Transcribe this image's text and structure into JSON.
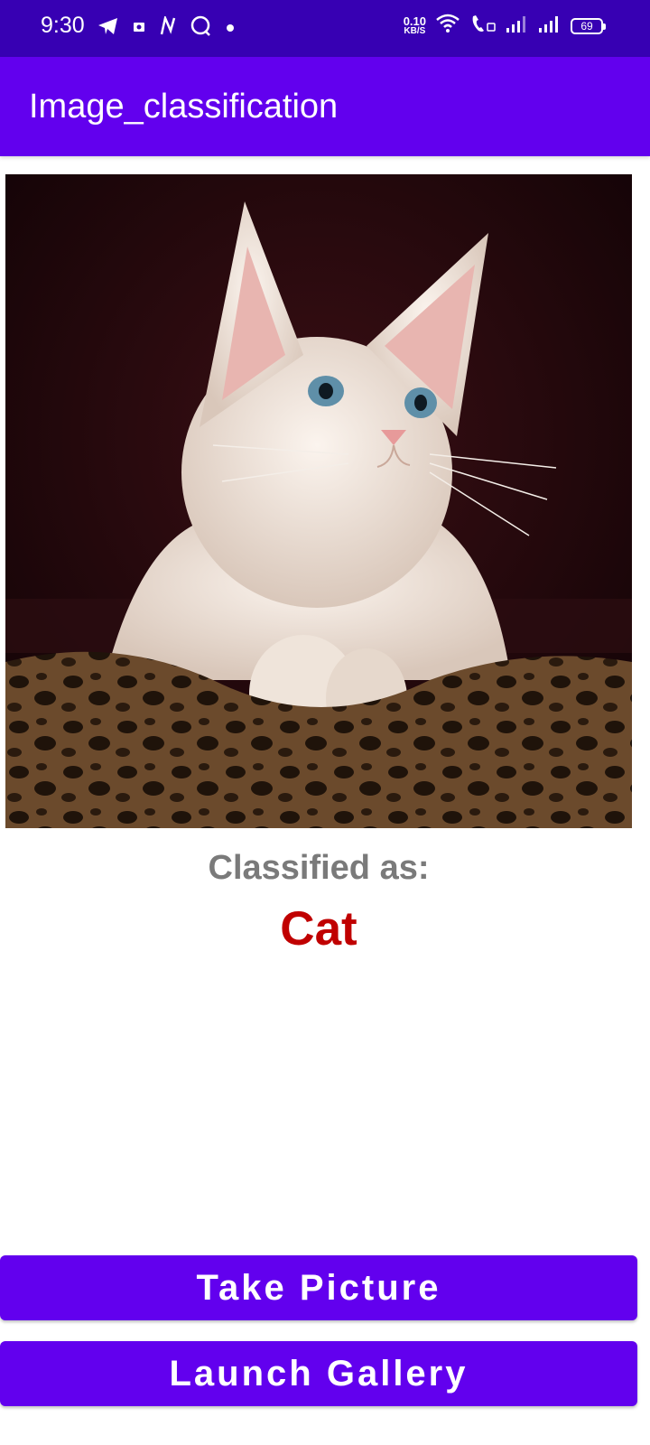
{
  "status_bar": {
    "time": "9:30",
    "net_speed_value": "0.10",
    "net_speed_unit": "KB/S",
    "battery": "69"
  },
  "app_bar": {
    "title": "Image_classification"
  },
  "main": {
    "image_subject": "cat-photo",
    "classified_label": "Classified as:",
    "result": "Cat"
  },
  "buttons": {
    "take_picture": "Take Picture",
    "launch_gallery": "Launch Gallery"
  },
  "colors": {
    "status_bar": "#3700b3",
    "primary": "#6200ee",
    "result_text": "#c00000",
    "label_text": "#7a7a7a"
  }
}
